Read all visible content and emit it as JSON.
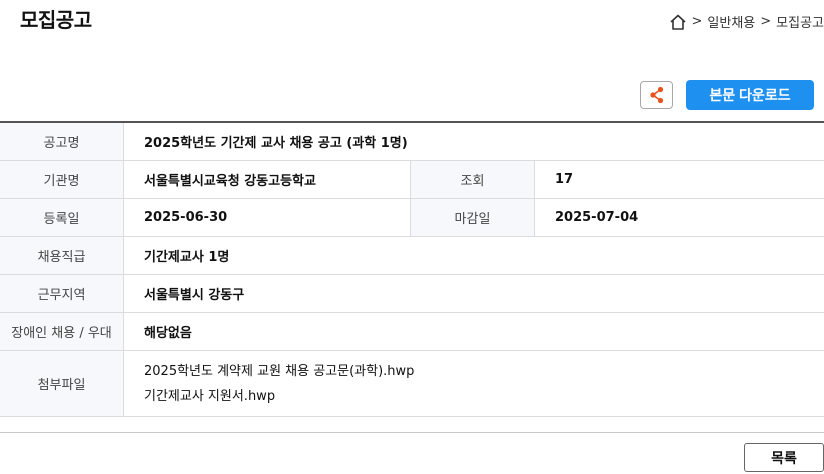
{
  "page_title": "모집공고",
  "breadcrumb": {
    "sep": ">",
    "level1": "일반채용",
    "level2": "모집공고"
  },
  "toolbar": {
    "share_icon": "share-icon",
    "download_label": "본문 다운로드"
  },
  "info": {
    "title_label": "공고명",
    "title_value": "2025학년도 기간제 교사 채용 공고 (과학 1명)",
    "org_label": "기관명",
    "org_value": "서울특별시교육청 강동고등학교",
    "views_label": "조회",
    "views_value": "17",
    "reg_label": "등록일",
    "reg_value": "2025-06-30",
    "deadline_label": "마감일",
    "deadline_value": "2025-07-04",
    "position_label": "채용직급",
    "position_value": "기간제교사 1명",
    "location_label": "근무지역",
    "location_value": "서울특별시 강동구",
    "disabled_label": "장애인 채용 / 우대",
    "disabled_value": "해당없음",
    "attach_label": "첨부파일",
    "attachments": [
      "2025학년도 계약제 교원 채용 공고문(과학).hwp",
      "기간제교사 지원서.hwp"
    ]
  },
  "list_button": "목록",
  "colors": {
    "accent": "#1e90f0",
    "share": "#e8531d"
  }
}
